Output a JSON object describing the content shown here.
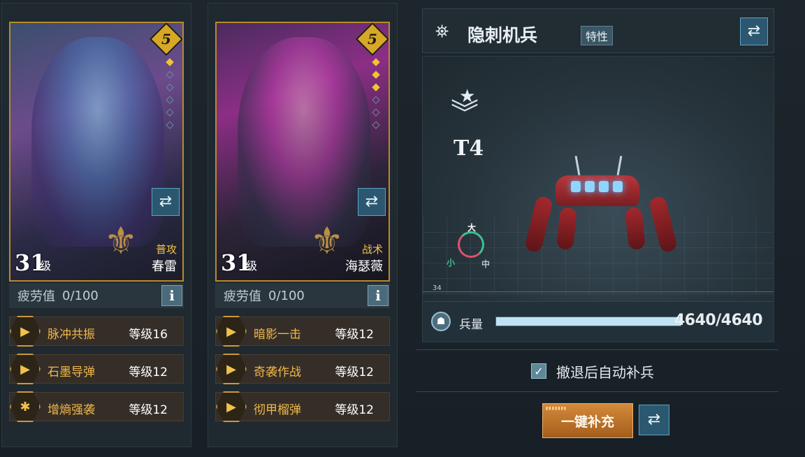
{
  "heroes": [
    {
      "stars": "5",
      "level": "31",
      "level_unit": "级",
      "role": "普攻",
      "name": "春雷",
      "fatigue_label": "疲劳值",
      "fatigue_value": "0/100",
      "info_label": "i",
      "star_pips": [
        1,
        0,
        0,
        0,
        0,
        0
      ],
      "skills": [
        {
          "name": "脉冲共振",
          "level": "等级16"
        },
        {
          "name": "石墨导弹",
          "level": "等级12"
        },
        {
          "name": "增熵强袭",
          "level": "等级12"
        }
      ]
    },
    {
      "stars": "5",
      "level": "31",
      "level_unit": "级",
      "role": "战术",
      "name": "海瑟薇",
      "fatigue_label": "疲劳值",
      "fatigue_value": "0/100",
      "info_label": "i",
      "star_pips": [
        1,
        1,
        1,
        0,
        0,
        0
      ],
      "skills": [
        {
          "name": "暗影一击",
          "level": "等级12"
        },
        {
          "name": "奇袭作战",
          "level": "等级12"
        },
        {
          "name": "彻甲榴弹",
          "level": "等级12"
        }
      ]
    }
  ],
  "unit": {
    "title": "隐刺机兵",
    "trait_label": "特性",
    "tier": "T4",
    "cycle": {
      "big": "大",
      "small": "小",
      "mid": "中"
    },
    "scale_tick": "34",
    "troops_label": "兵量",
    "troops_value": "4640/4640",
    "troops_fraction": 1.0,
    "auto_replenish_label": "撤退后自动补兵",
    "auto_replenish_checked": true,
    "replenish_button": "一键补充"
  },
  "icons": {
    "swap": "swap-arrows-icon",
    "unit": "mech-unit-icon",
    "star": "rank-star-icon",
    "chevron": "rank-chevron-icon",
    "troops": "helmet-icon",
    "check": "checkmark-icon"
  },
  "colors": {
    "card_border": "#b88a2c",
    "skill_name": "#f1b749",
    "accent_button": "#d38a3a",
    "swap_button": "#2b5870"
  }
}
